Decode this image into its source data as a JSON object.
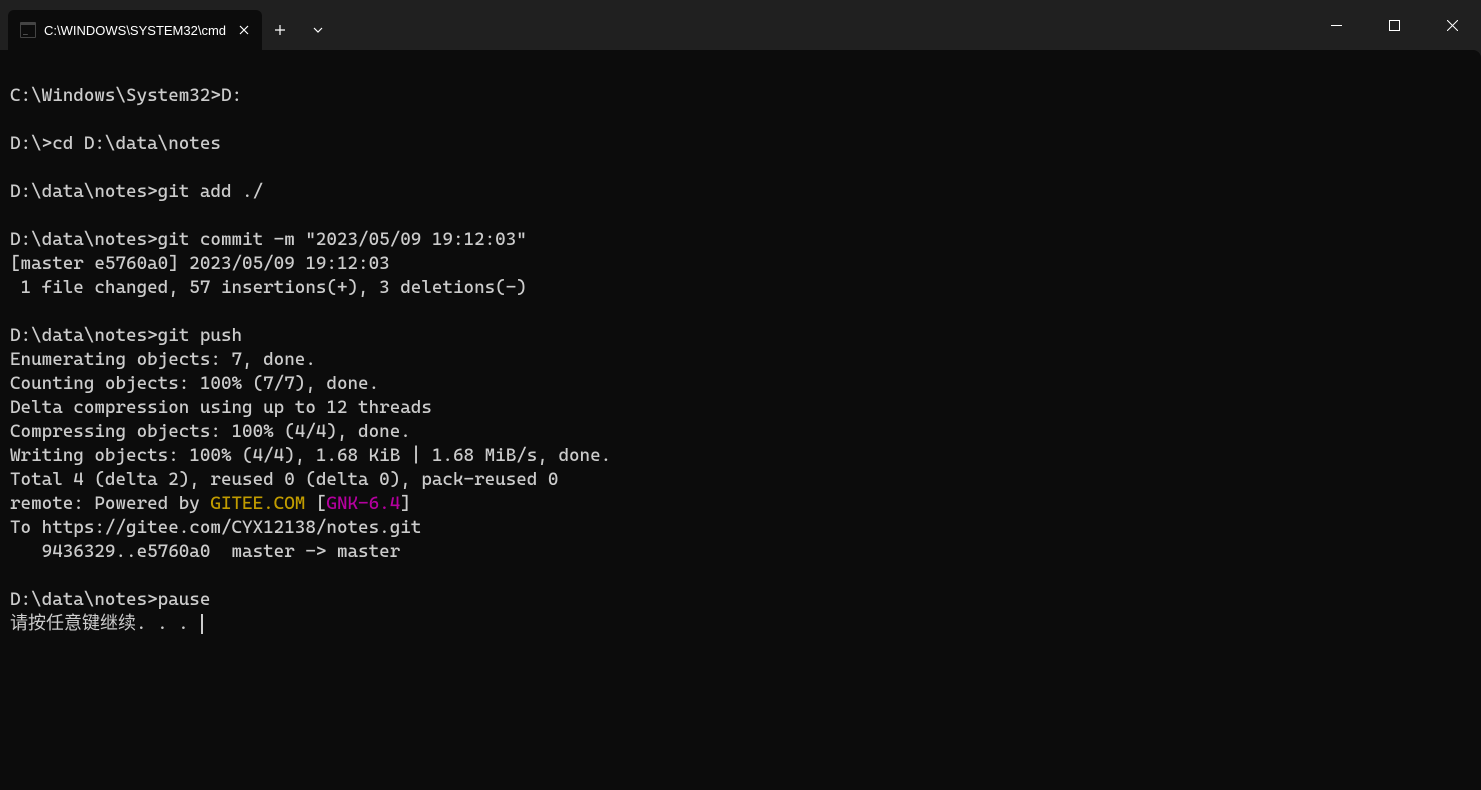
{
  "titlebar": {
    "tab_title": "C:\\WINDOWS\\SYSTEM32\\cmd"
  },
  "terminal": {
    "lines": [
      {
        "segments": [
          {
            "t": ""
          }
        ]
      },
      {
        "segments": [
          {
            "t": "C:\\Windows\\System32>D:"
          }
        ]
      },
      {
        "segments": [
          {
            "t": ""
          }
        ]
      },
      {
        "segments": [
          {
            "t": "D:\\>cd D:\\data\\notes"
          }
        ]
      },
      {
        "segments": [
          {
            "t": ""
          }
        ]
      },
      {
        "segments": [
          {
            "t": "D:\\data\\notes>git add ./"
          }
        ]
      },
      {
        "segments": [
          {
            "t": ""
          }
        ]
      },
      {
        "segments": [
          {
            "t": "D:\\data\\notes>git commit -m \"2023/05/09 19:12:03\""
          }
        ]
      },
      {
        "segments": [
          {
            "t": "[master e5760a0] 2023/05/09 19:12:03"
          }
        ]
      },
      {
        "segments": [
          {
            "t": " 1 file changed, 57 insertions(+), 3 deletions(-)"
          }
        ]
      },
      {
        "segments": [
          {
            "t": ""
          }
        ]
      },
      {
        "segments": [
          {
            "t": "D:\\data\\notes>git push"
          }
        ]
      },
      {
        "segments": [
          {
            "t": "Enumerating objects: 7, done."
          }
        ]
      },
      {
        "segments": [
          {
            "t": "Counting objects: 100% (7/7), done."
          }
        ]
      },
      {
        "segments": [
          {
            "t": "Delta compression using up to 12 threads"
          }
        ]
      },
      {
        "segments": [
          {
            "t": "Compressing objects: 100% (4/4), done."
          }
        ]
      },
      {
        "segments": [
          {
            "t": "Writing objects: 100% (4/4), 1.68 KiB | 1.68 MiB/s, done."
          }
        ]
      },
      {
        "segments": [
          {
            "t": "Total 4 (delta 2), reused 0 (delta 0), pack-reused 0"
          }
        ]
      },
      {
        "segments": [
          {
            "t": "remote: Powered by "
          },
          {
            "t": "GITEE.COM",
            "c": "yellow"
          },
          {
            "t": " ["
          },
          {
            "t": "GNK-6.4",
            "c": "magenta"
          },
          {
            "t": "]"
          }
        ]
      },
      {
        "segments": [
          {
            "t": "To https://gitee.com/CYX12138/notes.git"
          }
        ]
      },
      {
        "segments": [
          {
            "t": "   9436329..e5760a0  master -> master"
          }
        ]
      },
      {
        "segments": [
          {
            "t": ""
          }
        ]
      },
      {
        "segments": [
          {
            "t": "D:\\data\\notes>pause"
          }
        ]
      },
      {
        "segments": [
          {
            "t": "请按任意键继续. . . "
          }
        ],
        "cursor": true
      }
    ]
  }
}
